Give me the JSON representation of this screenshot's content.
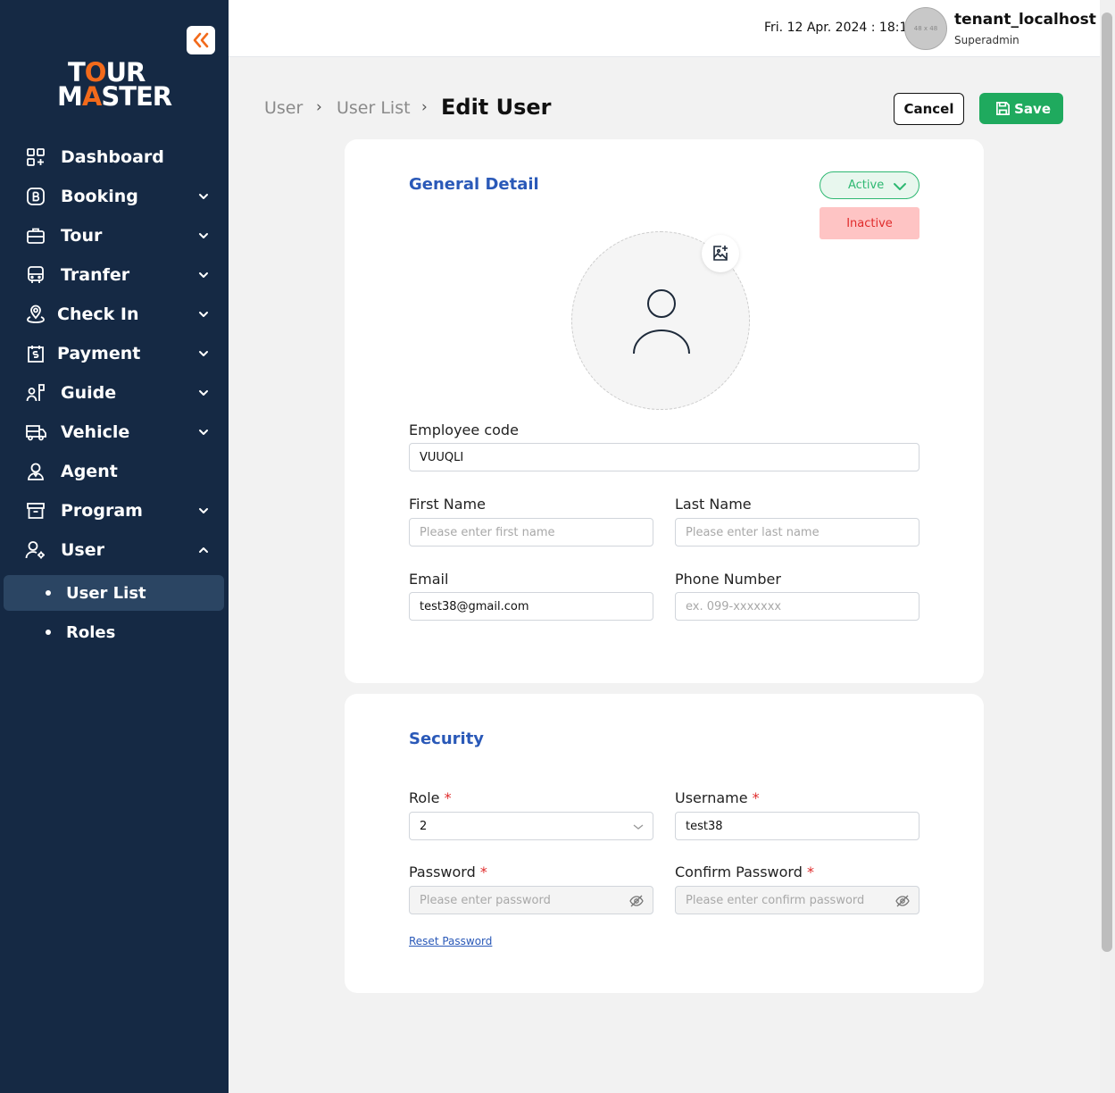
{
  "sidebar": {
    "logo": {
      "line1_a": "T",
      "line1_o": "O",
      "line1_b": "UR",
      "line2_a": "M",
      "line2_o": "A",
      "line2_b": "STER"
    },
    "items": [
      {
        "label": "Dashboard",
        "icon": "dashboard-icon"
      },
      {
        "label": "Booking",
        "icon": "booking-icon"
      },
      {
        "label": "Tour",
        "icon": "briefcase-icon"
      },
      {
        "label": "Tranfer",
        "icon": "bus-icon"
      },
      {
        "label": "Check In",
        "icon": "location-pin-icon"
      },
      {
        "label": "Payment",
        "icon": "payment-receipt-icon"
      },
      {
        "label": "Guide",
        "icon": "guide-flag-icon"
      },
      {
        "label": "Vehicle",
        "icon": "vehicle-icon"
      },
      {
        "label": "Agent",
        "icon": "agent-icon"
      },
      {
        "label": "Program",
        "icon": "archive-box-icon"
      },
      {
        "label": "User",
        "icon": "user-settings-icon"
      }
    ],
    "user_sub": [
      {
        "label": "User List",
        "active": true
      },
      {
        "label": "Roles",
        "active": false
      }
    ]
  },
  "header": {
    "datetime": "Fri. 12 Apr. 2024 : 18:13",
    "avatar_placeholder": "48 x 48",
    "tenant_name": "tenant_localhost",
    "tenant_role": "Superadmin"
  },
  "breadcrumb": {
    "items": [
      "User",
      "User List"
    ],
    "current": "Edit User"
  },
  "actions": {
    "cancel": "Cancel",
    "save": "Save"
  },
  "general": {
    "title": "General Detail",
    "status_selected": "Active",
    "status_option": "Inactive",
    "employee_code": {
      "label": "Employee code",
      "value": "VUUQLI"
    },
    "first_name": {
      "label": "First Name",
      "placeholder": "Please enter first name"
    },
    "last_name": {
      "label": "Last Name",
      "placeholder": "Please enter last name"
    },
    "email": {
      "label": "Email",
      "value": "test38@gmail.com"
    },
    "phone": {
      "label": "Phone Number",
      "placeholder": "ex. 099-xxxxxxx"
    }
  },
  "security": {
    "title": "Security",
    "role": {
      "label": "Role",
      "value": "2"
    },
    "username": {
      "label": "Username",
      "value": "test38"
    },
    "password": {
      "label": "Password",
      "placeholder": "Please enter password"
    },
    "confirm_password": {
      "label": "Confirm Password",
      "placeholder": "Please enter confirm password"
    },
    "required_mark": "*",
    "reset_link": "Reset Password"
  },
  "colors": {
    "sidebar_bg": "#152944",
    "brand_orange": "#f26a1b",
    "save_green": "#1faa5e",
    "title_blue": "#2a59b8",
    "active_green": "#2eb872",
    "inactive_red": "#e02b2b"
  }
}
